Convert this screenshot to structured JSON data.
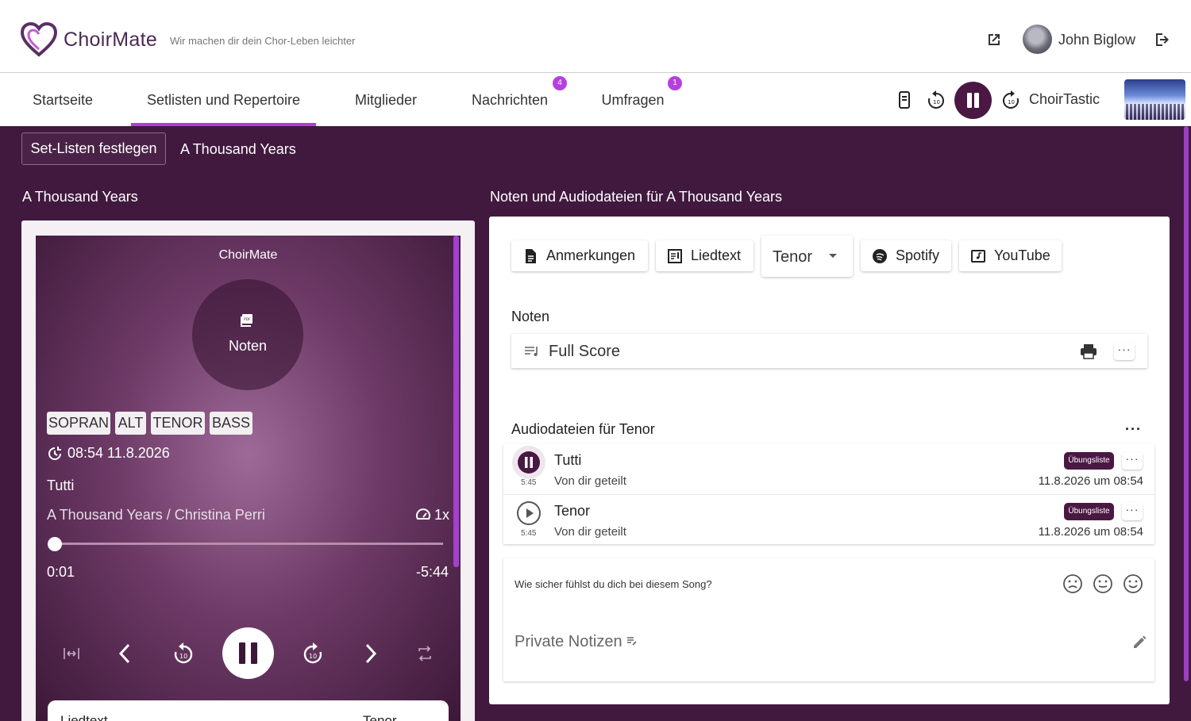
{
  "header": {
    "brand": "ChoirMate",
    "tagline": "Wir machen dir dein Chor-Leben leichter",
    "user_name": "John Biglow",
    "icons": [
      "heart-logo-icon",
      "external-link-icon",
      "avatar",
      "logout-icon"
    ]
  },
  "nav": {
    "tabs": [
      {
        "label": "Startseite"
      },
      {
        "label": "Setlisten und Repertoire",
        "active": true
      },
      {
        "label": "Mitglieder"
      },
      {
        "label": "Nachrichten",
        "badge": "4"
      },
      {
        "label": "Umfragen",
        "badge": "1"
      }
    ],
    "choir_name": "ChoirTastic",
    "icons": [
      "phone-icon",
      "rewind-10-icon",
      "pause-icon",
      "forward-10-icon"
    ]
  },
  "breadcrumb": {
    "button_label": "Set-Listen festlegen",
    "current": "A Thousand Years"
  },
  "left": {
    "section_title": "A Thousand Years",
    "player": {
      "header": "ChoirMate",
      "noten_label": "Noten",
      "voices": [
        "SOPRAN",
        "ALT",
        "TENOR",
        "BASS"
      ],
      "timestamp": "08:54 11.8.2026",
      "track_title": "Tutti",
      "song_line": "A Thousand Years / Christina Perri",
      "speed": "1x",
      "progress_fraction": 0.003,
      "elapsed": "0:01",
      "remaining": "-5:44",
      "lyrics_label": "Liedtext",
      "lyrics_voice": "Tenor"
    }
  },
  "right": {
    "section_title": "Noten und Audiodateien für A Thousand Years",
    "chips": {
      "anmerkungen": "Anmerkungen",
      "liedtext": "Liedtext",
      "voice_select": "Tenor",
      "spotify": "Spotify",
      "youtube": "YouTube"
    },
    "noten_heading": "Noten",
    "score_label": "Full Score",
    "more": "···",
    "audio_heading": "Audiodateien für Tenor",
    "audio_more": "···",
    "audio": [
      {
        "name": "Tutti",
        "duration": "5:45",
        "shared": "Von dir geteilt",
        "tag": "Übungsliste",
        "date": "11.8.2026 um 08:54",
        "state": "playing"
      },
      {
        "name": "Tenor",
        "duration": "5:45",
        "shared": "Von dir geteilt",
        "tag": "Übungsliste",
        "date": "11.8.2026 um 08:54",
        "state": "paused"
      }
    ],
    "feedback_question": "Wie sicher fühlst du dich bei diesem Song?",
    "notes_placeholder": "Private Notizen"
  },
  "colors": {
    "background_purple": "#41193f",
    "accent_purple": "#b43bd6",
    "dark_plum": "#4a1842"
  }
}
